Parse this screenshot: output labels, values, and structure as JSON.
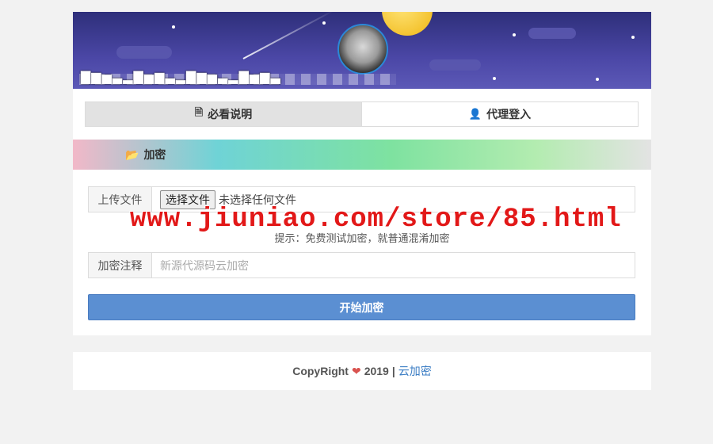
{
  "banner": {
    "obscured_text": "▇▆▅▃▂▇▅▆▃▂▇▆▅▃▂▇▅▆▃"
  },
  "tabs": [
    {
      "label": "必看说明",
      "icon": "file-icon",
      "active": true
    },
    {
      "label": "代理登入",
      "icon": "user-icon",
      "active": false
    }
  ],
  "section": {
    "title": "加密",
    "icon": "folder-open-icon"
  },
  "form": {
    "upload": {
      "label": "上传文件",
      "button": "选择文件",
      "status": "未选择任何文件"
    },
    "hint": "提示：免费测试加密，就普通混淆加密",
    "note": {
      "label": "加密注释",
      "placeholder": "新源代源码云加密"
    },
    "submit": "开始加密"
  },
  "watermark": "www.jiuniao.com/store/85.html",
  "footer": {
    "copyright": "CopyRight",
    "year": "2019",
    "separator": "|",
    "link": "云加密"
  },
  "colors": {
    "primary_button": "#5b8fd2",
    "heart": "#d9534f",
    "link": "#3b7dc4",
    "banner": "#4b47a6"
  }
}
